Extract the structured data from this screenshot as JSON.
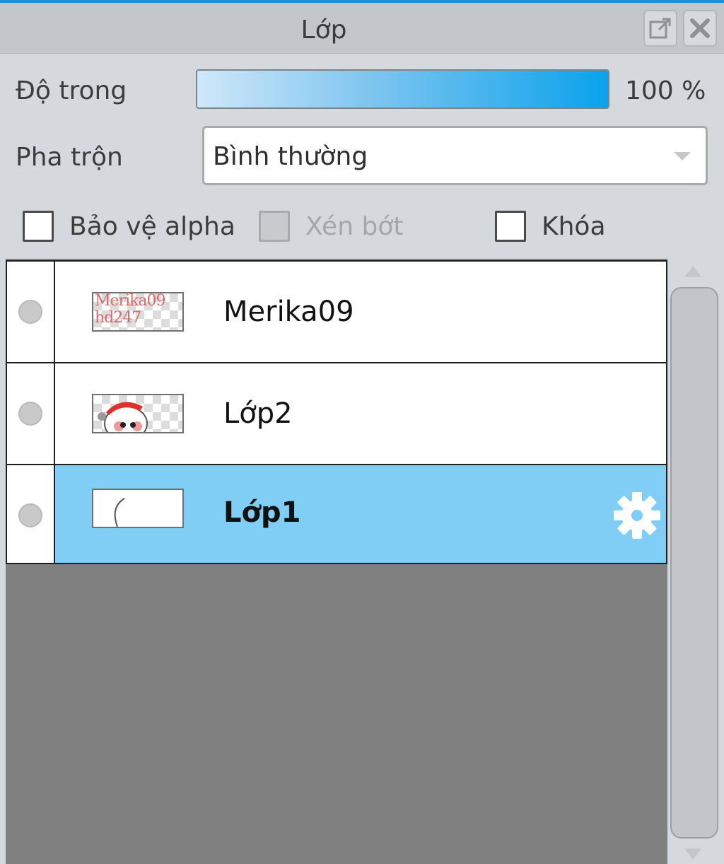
{
  "panel": {
    "title": "Lớp"
  },
  "titlebar": {
    "popout_icon": "popout-icon",
    "close_icon": "close-icon"
  },
  "opacity": {
    "label": "Độ trong",
    "value_text": "100 %",
    "fraction": 1.0
  },
  "blend": {
    "label": "Pha trộn",
    "selected": "Bình thường"
  },
  "checkboxes": {
    "alpha_protect": {
      "label": "Bảo vệ alpha",
      "checked": false
    },
    "clip": {
      "label": "Xén bớt",
      "checked": false,
      "disabled": true
    },
    "lock": {
      "label": "Khóa",
      "checked": false
    }
  },
  "layers": [
    {
      "name": "Merika09",
      "thumb_text": "Merika09\nhd247",
      "selected": false
    },
    {
      "name": "Lớp2",
      "selected": false
    },
    {
      "name": "Lớp1",
      "selected": true
    }
  ],
  "colors": {
    "accent": "#1a8fd8",
    "selected_row": "#80cdf5",
    "panel_bg": "#d5d8dc",
    "list_empty_bg": "#808080"
  }
}
